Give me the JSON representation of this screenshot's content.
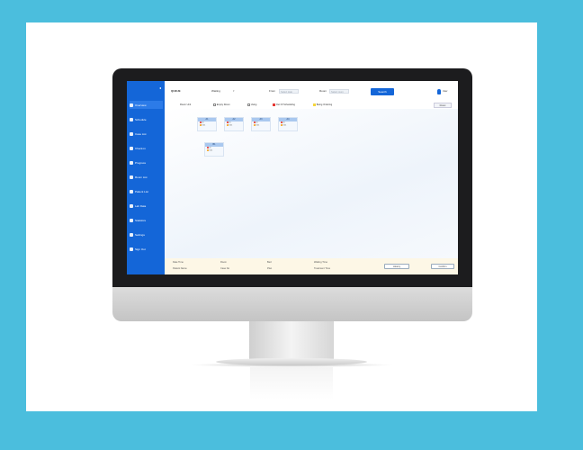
{
  "sidebar": {
    "items": [
      {
        "label": "Overview",
        "icon": "home-icon"
      },
      {
        "label": "Schedule",
        "icon": "calendar-icon"
      },
      {
        "label": "Case List",
        "icon": "list-icon"
      },
      {
        "label": "Check-in",
        "icon": "checkin-icon"
      },
      {
        "label": "Progress",
        "icon": "progress-icon"
      },
      {
        "label": "Room List",
        "icon": "room-icon"
      },
      {
        "label": "Patient List",
        "icon": "patient-icon"
      },
      {
        "label": "Lab Data",
        "icon": "lab-icon"
      },
      {
        "label": "Statistics",
        "icon": "stats-icon"
      },
      {
        "label": "Settings",
        "icon": "gear-icon"
      },
      {
        "label": "Sign Out",
        "icon": "logout-icon"
      }
    ]
  },
  "topbar": {
    "title": "QUEUE",
    "status_label": "Waiting",
    "from_label": "From",
    "from_placeholder": "Select date",
    "room_label": "Room",
    "room_placeholder": "Select room",
    "search_button": "Search",
    "user_label": "User"
  },
  "filters": {
    "room_label": "Room Unit",
    "legend": [
      {
        "label": "Empty Room",
        "color": "#ffffff"
      },
      {
        "label": "Using",
        "color": "#ffffff"
      },
      {
        "label": "Out Of Scheduling",
        "color": "#e53935"
      },
      {
        "label": "Being Ordering",
        "color": "#f5d53b"
      }
    ],
    "reset_button": "Reset"
  },
  "main": {
    "rows": [
      {
        "label": "",
        "tiles": [
          {
            "name": "A1",
            "lines": [
              "21",
              "C61"
            ]
          },
          {
            "name": "A2",
            "lines": [
              "21",
              "C61"
            ]
          },
          {
            "name": "A3",
            "lines": [
              "21",
              "C61"
            ]
          },
          {
            "name": "A4",
            "lines": [
              "21",
              "C61"
            ]
          }
        ]
      },
      {
        "label": "",
        "tiles": [
          {
            "name": "B1",
            "lines": [
              "21",
              "C61"
            ]
          }
        ]
      }
    ]
  },
  "bottombar": {
    "col1": [
      "Date Time",
      "Patient Name"
    ],
    "col2": [
      "Room",
      "Case No"
    ],
    "col3": [
      "Bed",
      "Plan"
    ],
    "col4": [
      "Waiting Time",
      "Treatment Time"
    ],
    "left_button": "History",
    "right_button": "Confirm"
  },
  "colors": {
    "frame": "#4bbedd",
    "accent": "#1466d8",
    "footer": "#fdf7e6"
  }
}
